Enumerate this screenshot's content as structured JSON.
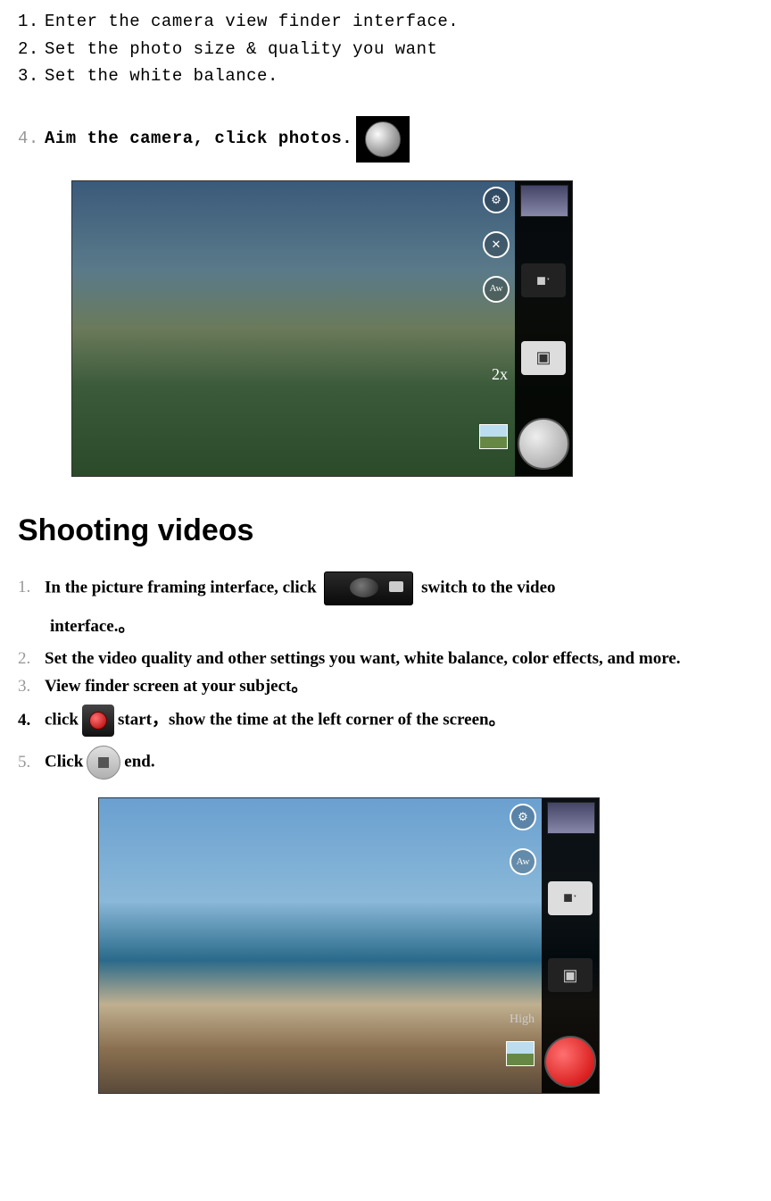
{
  "photo_steps": {
    "n1": "1.",
    "t1": "Enter the camera view finder interface.",
    "n2": "2.",
    "t2": "Set the photo size & quality you want",
    "n3": "3.",
    "t3": "Set the white balance.",
    "n4": "4.",
    "t4": "Aim the camera, click photos."
  },
  "heading": "Shooting videos",
  "video_steps": {
    "n1": "1.",
    "t1a": "In the picture framing interface, click ",
    "t1b": " switch to the video",
    "t1c": "interface.。",
    "n2": "2.",
    "t2": "Set the video quality and other settings you want, white balance, color effects, and more.",
    "n3": "3.",
    "t3": "View finder screen at your subject。",
    "n4": "4.",
    "t4a": "click",
    "t4b": "start，show the time at the left corner of the screen。",
    "n5": "5.",
    "t5a": "Click",
    "t5b": "end."
  },
  "preview1": {
    "zoom": "2x"
  },
  "preview2": {
    "quality": "High"
  }
}
